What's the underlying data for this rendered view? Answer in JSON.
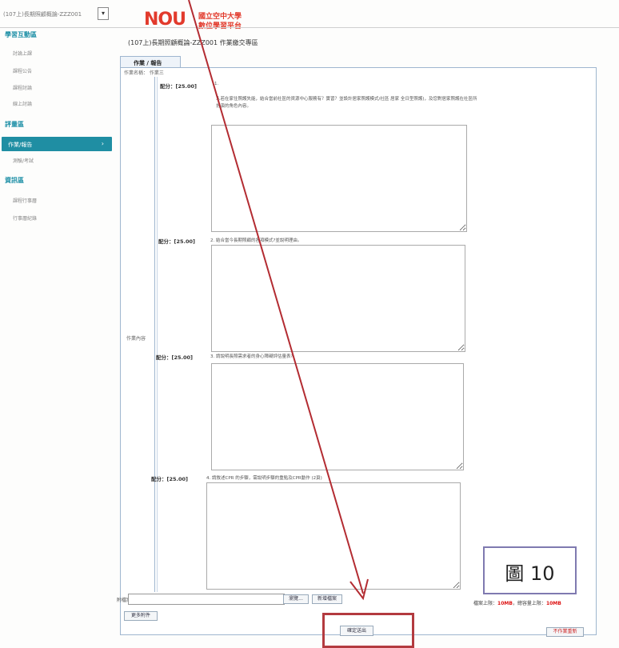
{
  "header": {
    "course_select": "(107上)長期照顧概論-ZZZ001",
    "logo_mark": "NOU",
    "logo_line1": "國立空中大學",
    "logo_line2": "數位學習平台"
  },
  "sidebar": {
    "sections": [
      {
        "title": "學習互動區",
        "items": [
          "討論上課",
          "課程公告",
          "課程討論",
          "線上討論"
        ]
      },
      {
        "title": "評量區",
        "items": [
          "作業/報告",
          "測驗/考試"
        ],
        "active": "作業/報告"
      },
      {
        "title": "資訊區",
        "items": [
          "課程行事曆",
          "行事曆紀錄"
        ]
      }
    ]
  },
  "main": {
    "page_title": "(107上)長期照顧概論-ZZZ001 作業繳交專區",
    "tab_label": "作業 / 報告",
    "crumb": "作業名稱： 作業三",
    "content_label": "作業內容",
    "questions": [
      {
        "score": "配分：[25.00]",
        "text": "1.",
        "text2": "人若在家住照護失能，結合當前社區的資源中心服務有？實習？並設計居家照護模式/社區 居家 全日型照護)，及您對居家照護在社區所扮演的角色內容。"
      },
      {
        "score": "配分：[25.00]",
        "text": "2. 結合當今長期照顧的各項模式?並說明理由。"
      },
      {
        "score": "配分：[25.00]",
        "text": "3. 請說明長照需求者的身心障礙評估量表?"
      },
      {
        "score": "配分：[25.00]",
        "text": "4. 請敘述CPR 的步驟，需說明步驟的重點及CPR動作 (2頁)"
      }
    ],
    "attachment_label": "附檔案位置",
    "browse_button": "瀏覽...",
    "upload_button": "新增檔案",
    "add_attachment_button": "更多附件",
    "quota": {
      "prefix": "檔案上限：",
      "value1": "10MB",
      "middle": "，總容量上限：",
      "value2": "10MB"
    },
    "submit_button": "確定送出",
    "not_submit_button": "不作業重新"
  },
  "figure_label": "圖 10",
  "colors": {
    "accent": "#1f8ea3",
    "logo": "#e23a2c",
    "arrow": "#b32c32",
    "highlight": "#b33a3f"
  }
}
